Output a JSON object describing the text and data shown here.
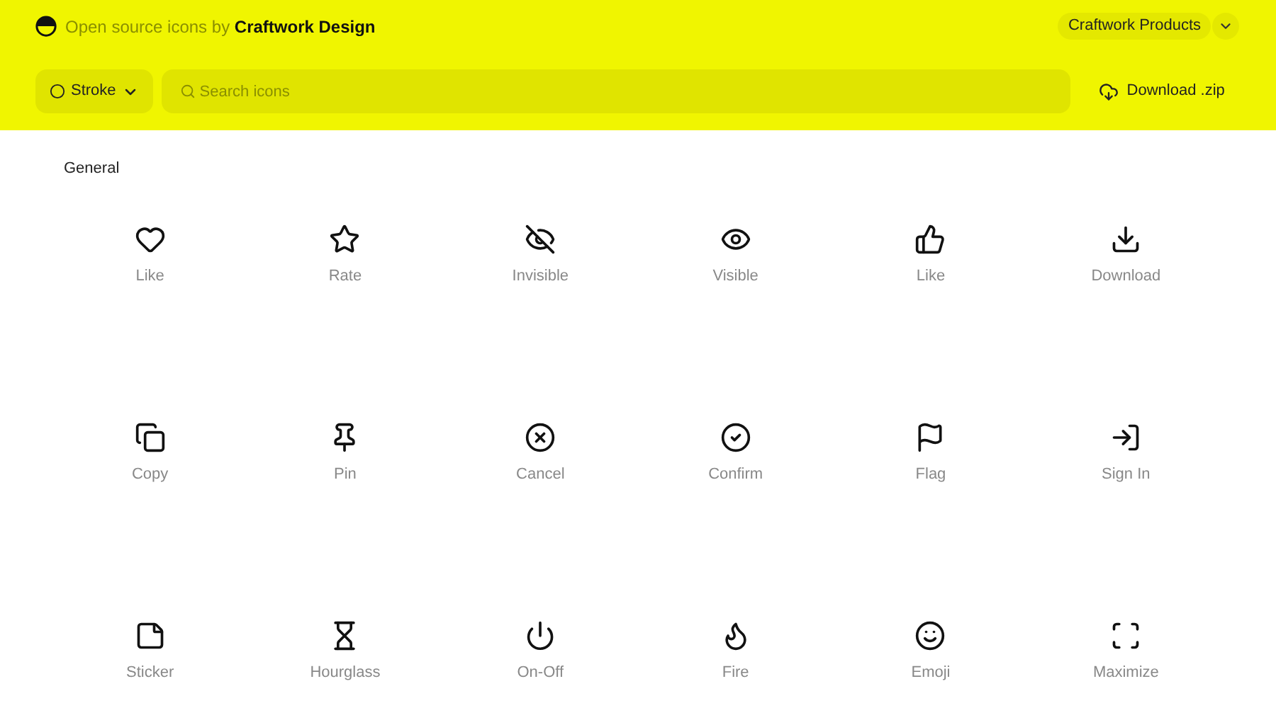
{
  "header": {
    "tagline": "Open source icons by **Craftwork Design**",
    "products_button": "Craftwork Products",
    "style_select": "Stroke",
    "search": {
      "placeholder": "Search icons"
    },
    "download_button": "Download .zip"
  },
  "section": {
    "title": "General",
    "icons": [
      {
        "label": "Like"
      },
      {
        "label": "Rate"
      },
      {
        "label": "Invisible"
      },
      {
        "label": "Visible"
      },
      {
        "label": "Like"
      },
      {
        "label": "Download"
      },
      {
        "label": "Copy"
      },
      {
        "label": "Pin"
      },
      {
        "label": "Cancel"
      },
      {
        "label": "Confirm"
      },
      {
        "label": "Flag"
      },
      {
        "label": "Sign In"
      },
      {
        "label": "Sticker"
      },
      {
        "label": "Hourglass"
      },
      {
        "label": "On-Off"
      },
      {
        "label": "Fire"
      },
      {
        "label": "Emoji"
      },
      {
        "label": "Maximize"
      }
    ]
  }
}
